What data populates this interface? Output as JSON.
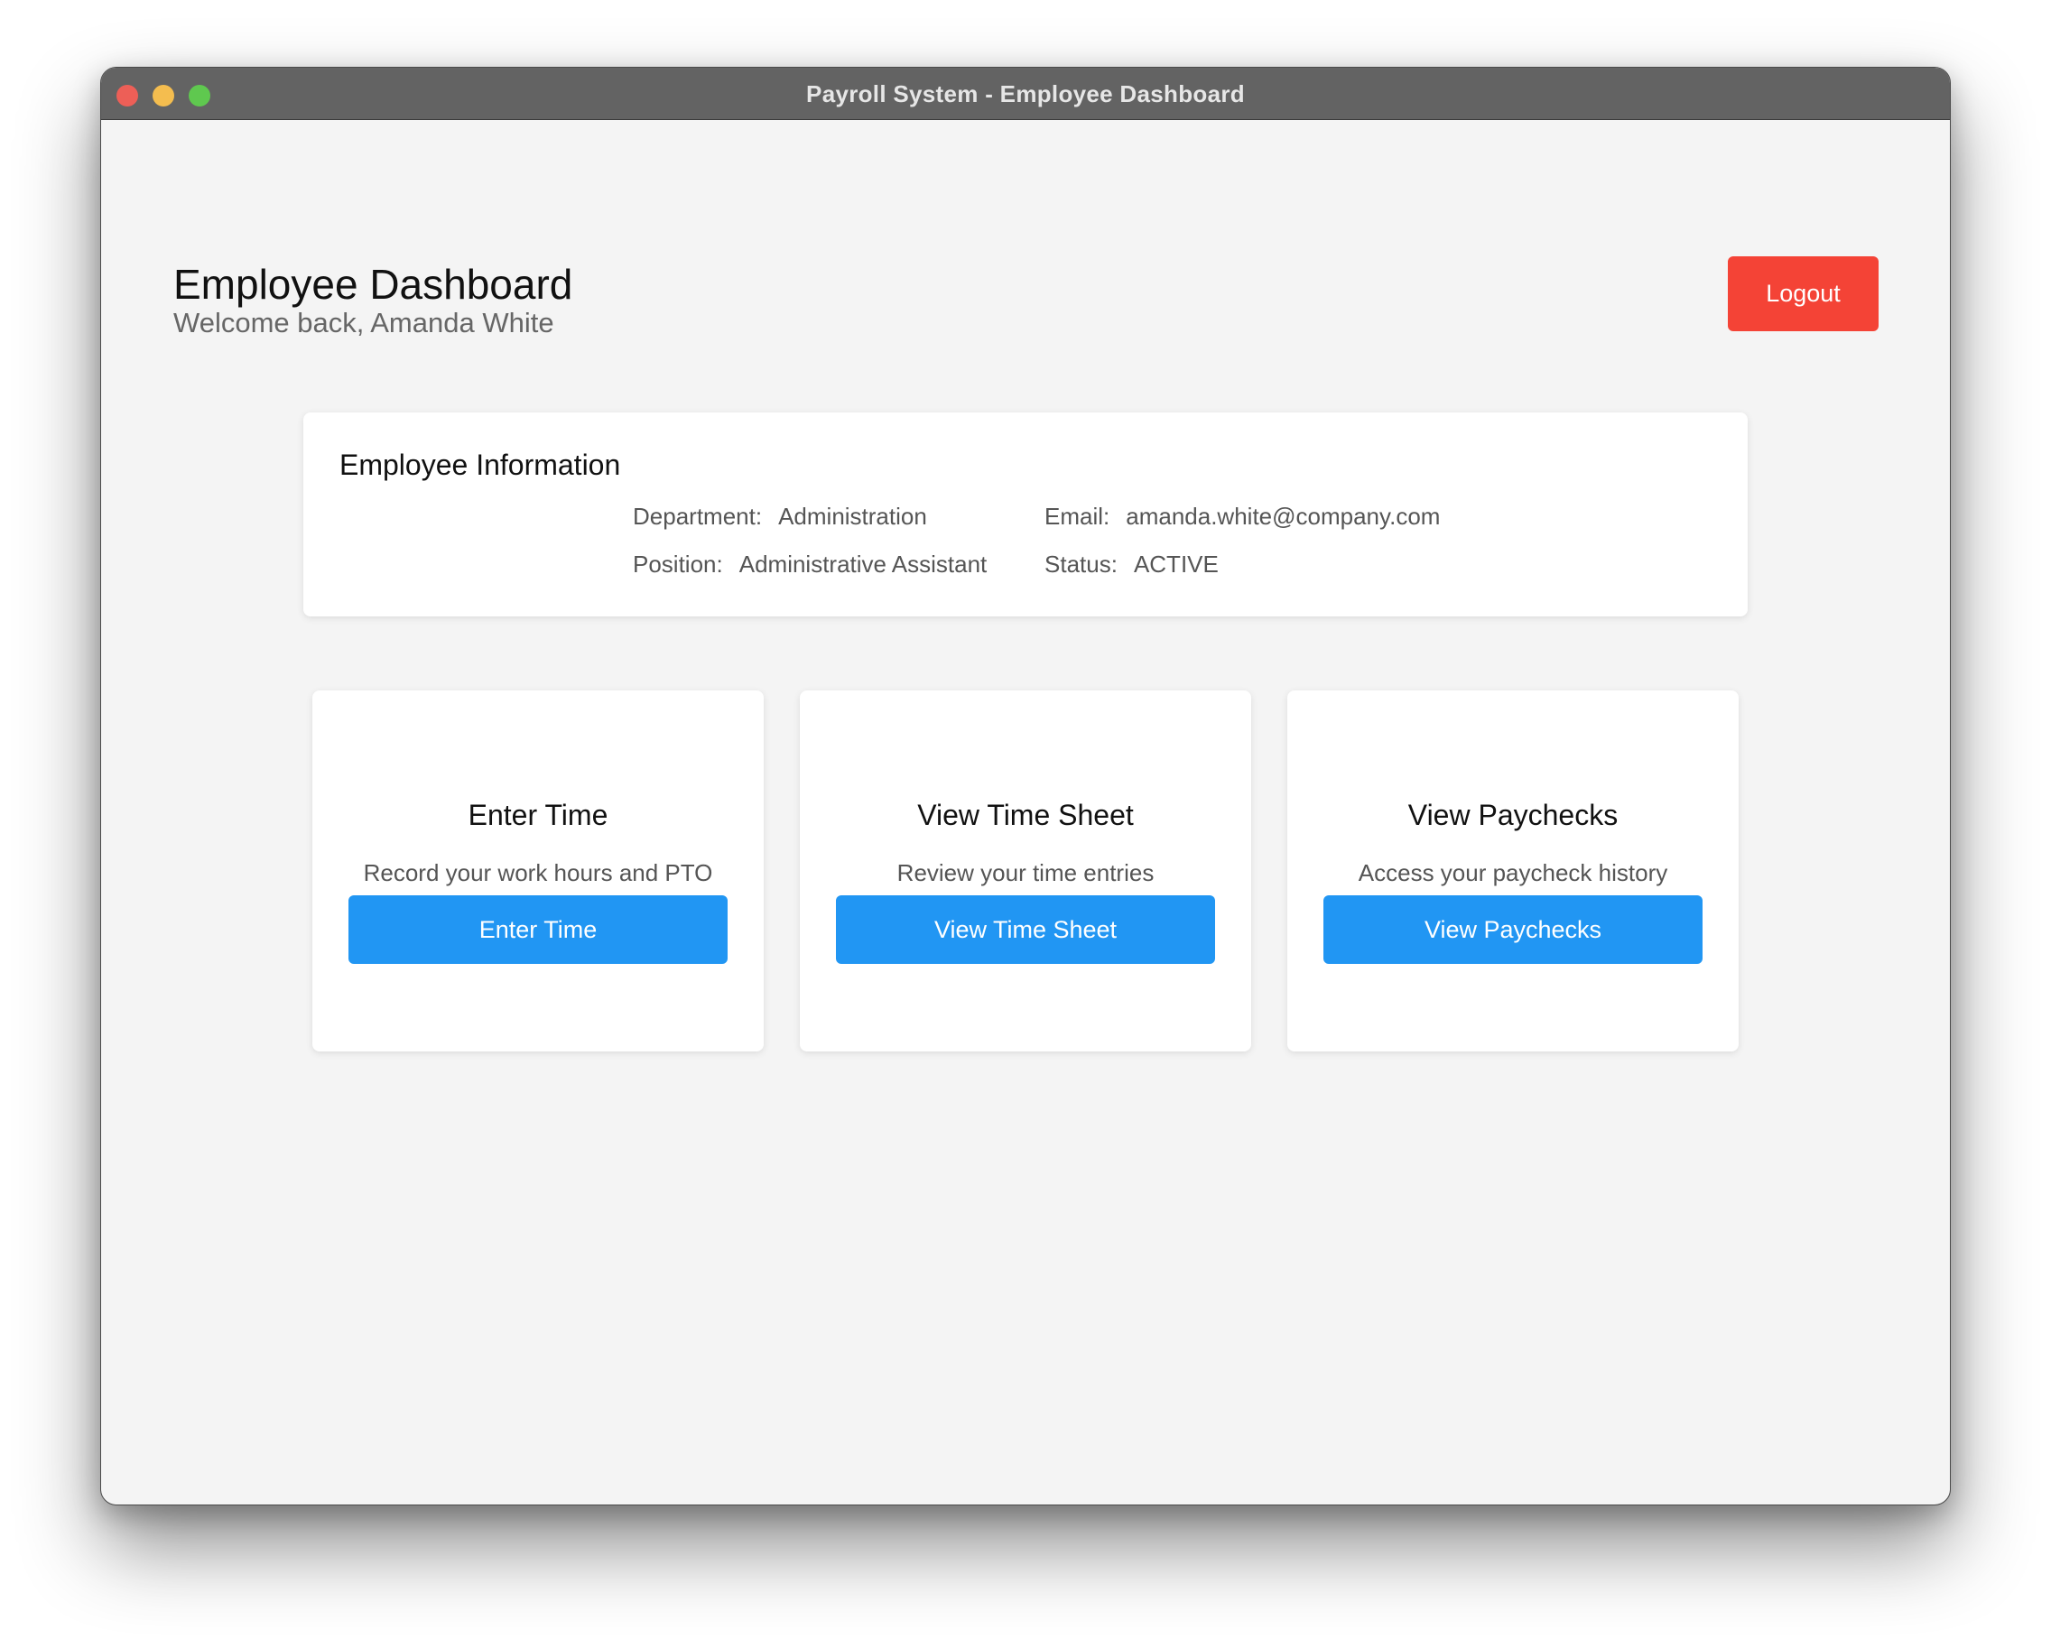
{
  "window": {
    "title": "Payroll System - Employee Dashboard"
  },
  "header": {
    "title": "Employee Dashboard",
    "welcome": "Welcome back, Amanda White",
    "logout_label": "Logout"
  },
  "employee_info": {
    "title": "Employee Information",
    "department_label": "Department:",
    "department_value": "Administration",
    "position_label": "Position:",
    "position_value": "Administrative Assistant",
    "email_label": "Email:",
    "email_value": "amanda.white@company.com",
    "status_label": "Status:",
    "status_value": "ACTIVE"
  },
  "actions": [
    {
      "title": "Enter Time",
      "description": "Record your work hours and PTO",
      "button_label": "Enter Time"
    },
    {
      "title": "View Time Sheet",
      "description": "Review your time entries",
      "button_label": "View Time Sheet"
    },
    {
      "title": "View Paychecks",
      "description": "Access your paycheck history",
      "button_label": "View Paychecks"
    }
  ],
  "colors": {
    "logout": "#f44336",
    "primary_button": "#2196f3",
    "background": "#f4f4f4",
    "titlebar": "#636363"
  }
}
